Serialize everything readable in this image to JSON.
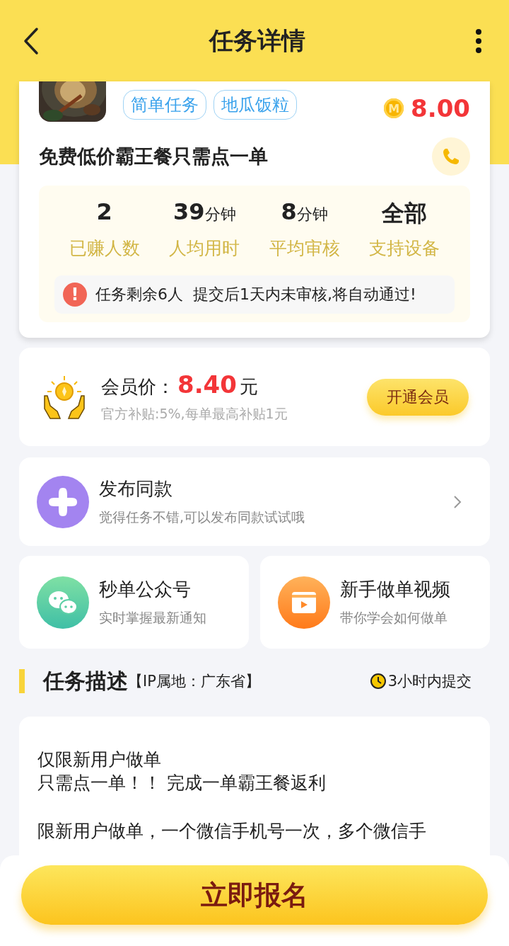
{
  "header": {
    "title": "任务详情"
  },
  "task": {
    "tags": [
      "简单任务",
      "地瓜饭粒"
    ],
    "coin_label": "M",
    "price": "8.00",
    "title": "免费低价霸王餐只需点一单",
    "stats": [
      {
        "value": "2",
        "label": "已赚人数"
      },
      {
        "value": "39",
        "unit": "分钟",
        "label": "人均用时"
      },
      {
        "value": "8",
        "unit": "分钟",
        "label": "平均审核"
      },
      {
        "value": "全部",
        "label": "支持设备"
      }
    ],
    "notice_mark": "!",
    "notice": "任务剩余6人  提交后1天内未审核,将自动通过!"
  },
  "member": {
    "label": "会员价：",
    "price": "8.40",
    "currency": "元",
    "subtitle": "官方补贴:5%,每单最高补贴1元",
    "button": "开通会员"
  },
  "publish": {
    "title": "发布同款",
    "subtitle": "觉得任务不错,可以发布同款试试哦"
  },
  "shortcuts": [
    {
      "kind": "chat",
      "title": "秒单公众号",
      "subtitle": "实时掌握最新通知"
    },
    {
      "kind": "video",
      "title": "新手做单视频",
      "subtitle": "带你学会如何做单"
    }
  ],
  "description": {
    "title": "任务描述",
    "location": "【IP属地：广东省】",
    "deadline": "3小时内提交",
    "paragraphs": [
      {
        "lines": [
          "仅限新用户做单",
          "只需点一单！！ 完成一单霸王餐返利"
        ]
      },
      {
        "lines": [
          "限新用户做单，一个微信手机号一次，多个微信手"
        ]
      }
    ]
  },
  "signup_button": "立即报名"
}
